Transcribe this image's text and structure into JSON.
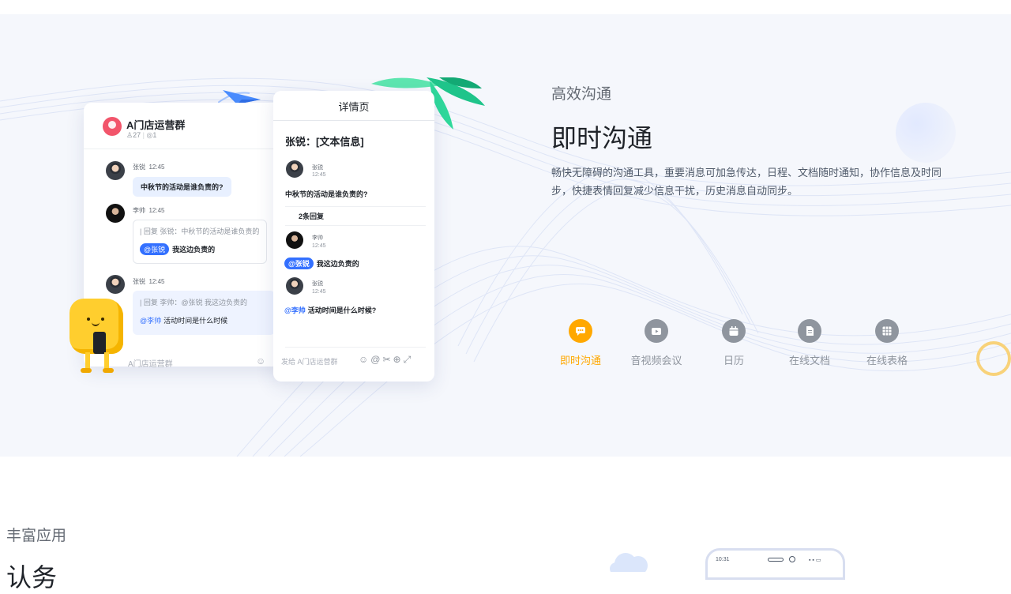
{
  "hero": {
    "eyebrow": "高效沟通",
    "headline": "即时沟通",
    "description": "畅快无障碍的沟通工具，重要消息可加急传达，日程、文档随时通知，协作信息及时同步，快捷表情回复减少信息干扰，历史消息自动同步。",
    "tabs": [
      {
        "label": "即时沟通",
        "icon": "chat-icon",
        "active": true
      },
      {
        "label": "音视频会议",
        "icon": "video-icon",
        "active": false
      },
      {
        "label": "日历",
        "icon": "calendar-icon",
        "active": false
      },
      {
        "label": "在线文档",
        "icon": "document-icon",
        "active": false
      },
      {
        "label": "在线表格",
        "icon": "sheet-icon",
        "active": false
      }
    ],
    "accent_color": "#ffa800"
  },
  "chat": {
    "group_name": "A门店运营群",
    "member_count": "27",
    "online_count": "1",
    "messages": [
      {
        "sender": "张锐",
        "time": "12:45",
        "text": "中秋节的活动是谁负责的?"
      },
      {
        "sender": "李帅",
        "time": "12:45",
        "quote": "| 回复 张锐：中秋节的活动是谁负责的",
        "mention": "@张锐",
        "text": "我这边负责的"
      },
      {
        "sender": "张锐",
        "time": "12:45",
        "quote": "| 回复 李帅：@张锐 我这边负责的",
        "mention": "@李帅",
        "text": "活动时间是什么时候"
      }
    ],
    "input_placeholder": "A门店运营群"
  },
  "detail": {
    "title": "详情页",
    "subject": "张锐：[文本信息]",
    "first": {
      "sender": "张锐",
      "time": "12:45",
      "text": "中秋节的活动是谁负责的?"
    },
    "reply_count": "2条回复",
    "replies": [
      {
        "sender": "李帅",
        "time": "12:45",
        "mention": "@张锐",
        "text": "我这边负责的"
      },
      {
        "sender": "张锐",
        "time": "12:45",
        "mention": "@李帅",
        "text": "活动时间是什么时候?"
      }
    ],
    "input_placeholder": "发给 A门店运营群"
  },
  "section2": {
    "eyebrow": "丰富应用",
    "headline": "认务",
    "phone_time": "10:31"
  }
}
